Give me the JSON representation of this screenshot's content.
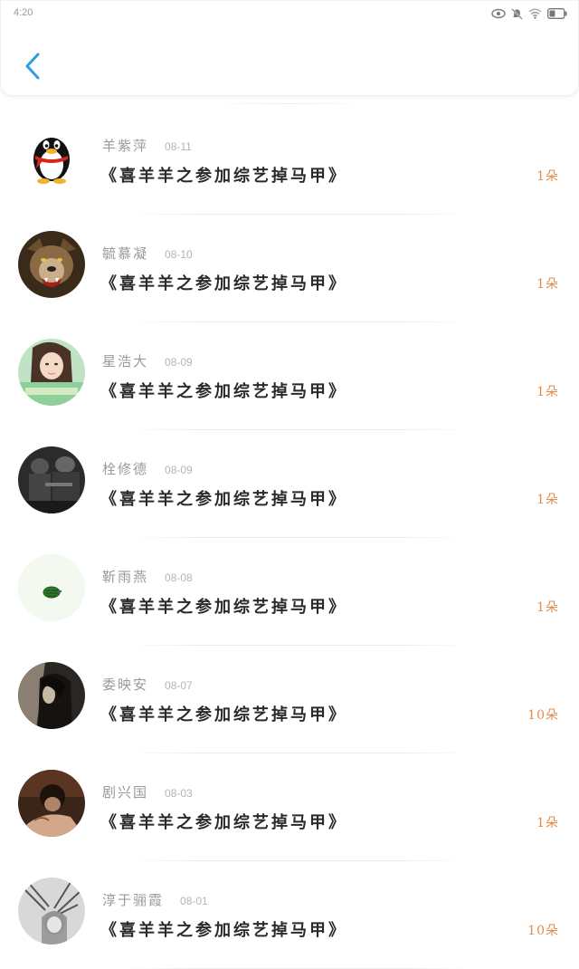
{
  "status_bar": {
    "time": "4:20",
    "icons": [
      "eye-icon",
      "mute-bell-icon",
      "wifi-icon",
      "battery-icon"
    ]
  },
  "header": {
    "back_icon": "chevron-left-icon",
    "accent_color": "#2f9be8"
  },
  "colors": {
    "count": "#e28c4a",
    "name": "#9a9a9a",
    "date": "#b5b5b5"
  },
  "items": [
    {
      "name": "羊紫萍",
      "date": "08-11",
      "title": "《喜羊羊之参加综艺掉马甲》",
      "count": "1朵",
      "avatar": "qq-penguin"
    },
    {
      "name": "毓慕凝",
      "date": "08-10",
      "title": "《喜羊羊之参加综艺掉马甲》",
      "count": "1朵",
      "avatar": "wolf"
    },
    {
      "name": "星浩大",
      "date": "08-09",
      "title": "《喜羊羊之参加综艺掉马甲》",
      "count": "1朵",
      "avatar": "girl-portrait"
    },
    {
      "name": "栓修德",
      "date": "08-09",
      "title": "《喜羊羊之参加综艺掉马甲》",
      "count": "1朵",
      "avatar": "soldiers"
    },
    {
      "name": "靳雨燕",
      "date": "08-08",
      "title": "《喜羊羊之参加综艺掉马甲》",
      "count": "1朵",
      "avatar": "watermelon"
    },
    {
      "name": "委映安",
      "date": "08-07",
      "title": "《喜羊羊之参加综艺掉马甲》",
      "count": "10朵",
      "avatar": "dark-figure"
    },
    {
      "name": "剧兴国",
      "date": "08-03",
      "title": "《喜羊羊之参加综艺掉马甲》",
      "count": "1朵",
      "avatar": "sepia-portrait"
    },
    {
      "name": "淳于骊霞",
      "date": "08-01",
      "title": "《喜羊羊之参加综艺掉马甲》",
      "count": "10朵",
      "avatar": "bw-plant-girl"
    }
  ]
}
